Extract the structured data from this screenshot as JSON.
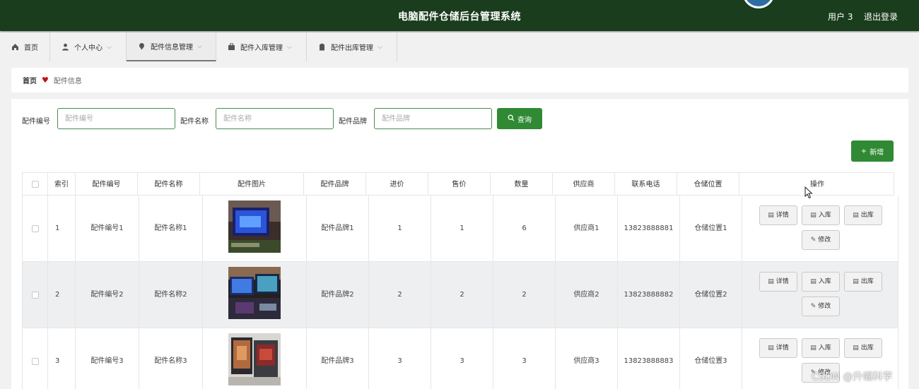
{
  "header": {
    "title": "电脑配件仓储后台管理系统",
    "user": "用户 3",
    "logout": "退出登录"
  },
  "nav": [
    {
      "label": "首页",
      "icon": "home-icon"
    },
    {
      "label": "个人中心",
      "icon": "user-icon"
    },
    {
      "label": "配件信息管理",
      "icon": "pin-icon"
    },
    {
      "label": "配件入库管理",
      "icon": "box-icon"
    },
    {
      "label": "配件出库管理",
      "icon": "clipboard-icon"
    }
  ],
  "breadcrumb": {
    "home": "首页",
    "current": "配件信息"
  },
  "search": {
    "code_label": "配件编号",
    "code_placeholder": "配件编号",
    "name_label": "配件名称",
    "name_placeholder": "配件名称",
    "brand_label": "配件品牌",
    "brand_placeholder": "配件品牌",
    "query_button": "查询"
  },
  "add_button": "新增",
  "table": {
    "columns": [
      "索引",
      "配件编号",
      "配件名称",
      "配件图片",
      "配件品牌",
      "进价",
      "售价",
      "数量",
      "供应商",
      "联系电话",
      "仓储位置",
      "操作"
    ],
    "rows": [
      {
        "index": "1",
        "code": "配件编号1",
        "name": "配件名称1",
        "brand": "配件品牌1",
        "buy": "1",
        "sell": "1",
        "qty": "6",
        "supplier": "供应商1",
        "phone": "13823888881",
        "location": "仓储位置1"
      },
      {
        "index": "2",
        "code": "配件编号2",
        "name": "配件名称2",
        "brand": "配件品牌2",
        "buy": "2",
        "sell": "2",
        "qty": "2",
        "supplier": "供应商2",
        "phone": "13823888882",
        "location": "仓储位置2"
      },
      {
        "index": "3",
        "code": "配件编号3",
        "name": "配件名称3",
        "brand": "配件品牌3",
        "buy": "3",
        "sell": "3",
        "qty": "3",
        "supplier": "供应商3",
        "phone": "13823888883",
        "location": "仓储位置3"
      }
    ],
    "actions": {
      "detail": "详情",
      "in": "入库",
      "out": "出库",
      "edit": "修改"
    }
  },
  "watermark": "CSDN @升幅科学",
  "colors": {
    "header_bg": "#1a3d1d",
    "accent_green": "#2f8a33",
    "breadcrumb_heart": "#c0121b"
  }
}
